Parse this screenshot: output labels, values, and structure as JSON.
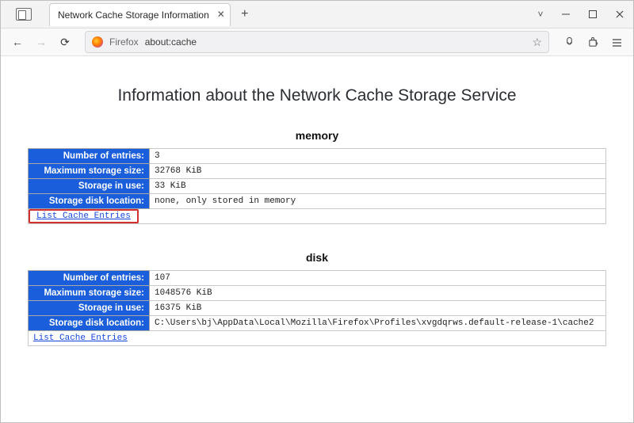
{
  "window": {
    "tab_title": "Network Cache Storage Information",
    "url_identity": "Firefox",
    "url_address": "about:cache",
    "tab_chevron": "˅"
  },
  "page": {
    "title": "Information about the Network Cache Storage Service"
  },
  "labels": {
    "entries": "Number of entries:",
    "max_size": "Maximum storage size:",
    "in_use": "Storage in use:",
    "disk_loc": "Storage disk location:",
    "list_link": "List Cache Entries"
  },
  "sections": [
    {
      "heading": "memory",
      "entries": "3",
      "max_size": "32768 KiB",
      "in_use": "33 KiB",
      "disk_loc": "none, only stored in memory",
      "highlight_link": true
    },
    {
      "heading": "disk",
      "entries": "107",
      "max_size": "1048576 KiB",
      "in_use": "16375 KiB",
      "disk_loc": "C:\\Users\\bj\\AppData\\Local\\Mozilla\\Firefox\\Profiles\\xvgdqrws.default-release-1\\cache2",
      "highlight_link": false
    }
  ]
}
